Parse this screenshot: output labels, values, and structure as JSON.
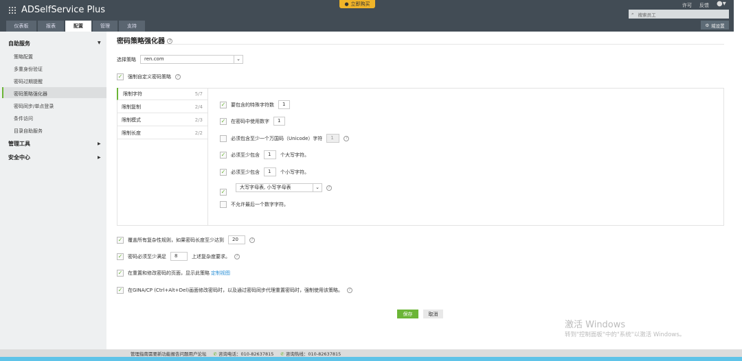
{
  "header": {
    "app_name": "ADSelfService Plus",
    "buy_now": "立即购买",
    "license": "许可",
    "feedback": "反馈",
    "search_placeholder": "搜索员工",
    "domain_settings": "域设置",
    "tabs": [
      "仪表板",
      "报表",
      "配置",
      "管理",
      "支持"
    ],
    "active_tab": "配置"
  },
  "sidebar": {
    "sections": [
      {
        "label": "自助服务",
        "items": [
          "策略配置",
          "多重身份验证",
          "密码过期提醒",
          "密码策略强化器",
          "密码同步/单点登录",
          "条件访问",
          "目录自助服务"
        ]
      },
      {
        "label": "管理工具"
      },
      {
        "label": "安全中心"
      }
    ],
    "selected": "密码策略强化器"
  },
  "main": {
    "title": "密码策略强化器",
    "select_policy_label": "选择策略",
    "policy_value": "ren.com",
    "enforce_custom": "强制自定义密码策略",
    "left_tabs": [
      {
        "label": "限制字符",
        "count": "5/7"
      },
      {
        "label": "限制复制",
        "count": "2/4"
      },
      {
        "label": "限制模式",
        "count": "2/3"
      },
      {
        "label": "限制长度",
        "count": "2/2"
      }
    ],
    "rules": {
      "special": "要包含的特殊字符数",
      "special_val": "1",
      "digit": "在密码中使用数字",
      "digit_val": "1",
      "unicode": "必须包含至少一个万国码（Unicode）字符",
      "unicode_val": "1",
      "upper_pre": "必须至少包含",
      "upper_val": "1",
      "upper_post": "个大写字符。",
      "lower_pre": "必须至少包含",
      "lower_val": "1",
      "lower_post": "个小写字符。",
      "charset": "大写字母表, 小写字母表",
      "no_last_digit": "不允许最后一个数字字符。"
    },
    "bypass_pre": "覆盖所有复杂性规则，如果密码长度至少达到",
    "bypass_val": "20",
    "meet_pre": "密码必须至少满足",
    "meet_val": "8",
    "meet_post": "上述复杂度要求。",
    "display": "在重置和修改密码的页面，显示此策略",
    "customize_link": "定制视图",
    "gina": "在GINA/CP (Ctrl+Alt+Del)画面修改密码时，以及通过密码同步代理重置密码时，强制使用该策略。",
    "save": "保存",
    "cancel": "取消"
  },
  "watermark": {
    "line1": "激活 Windows",
    "line2": "转到\"控制面板\"中的\"系统\"以激活 Windows。"
  },
  "footer": {
    "forum": "管理指南需要新功能报告问题用户论坛",
    "phone": "咨询电话：010-82637815",
    "hotline": "咨询热线：010-82637815"
  },
  "colors": {
    "header": "#424c55",
    "accent": "#6bb536",
    "link": "#2a8fd6"
  }
}
